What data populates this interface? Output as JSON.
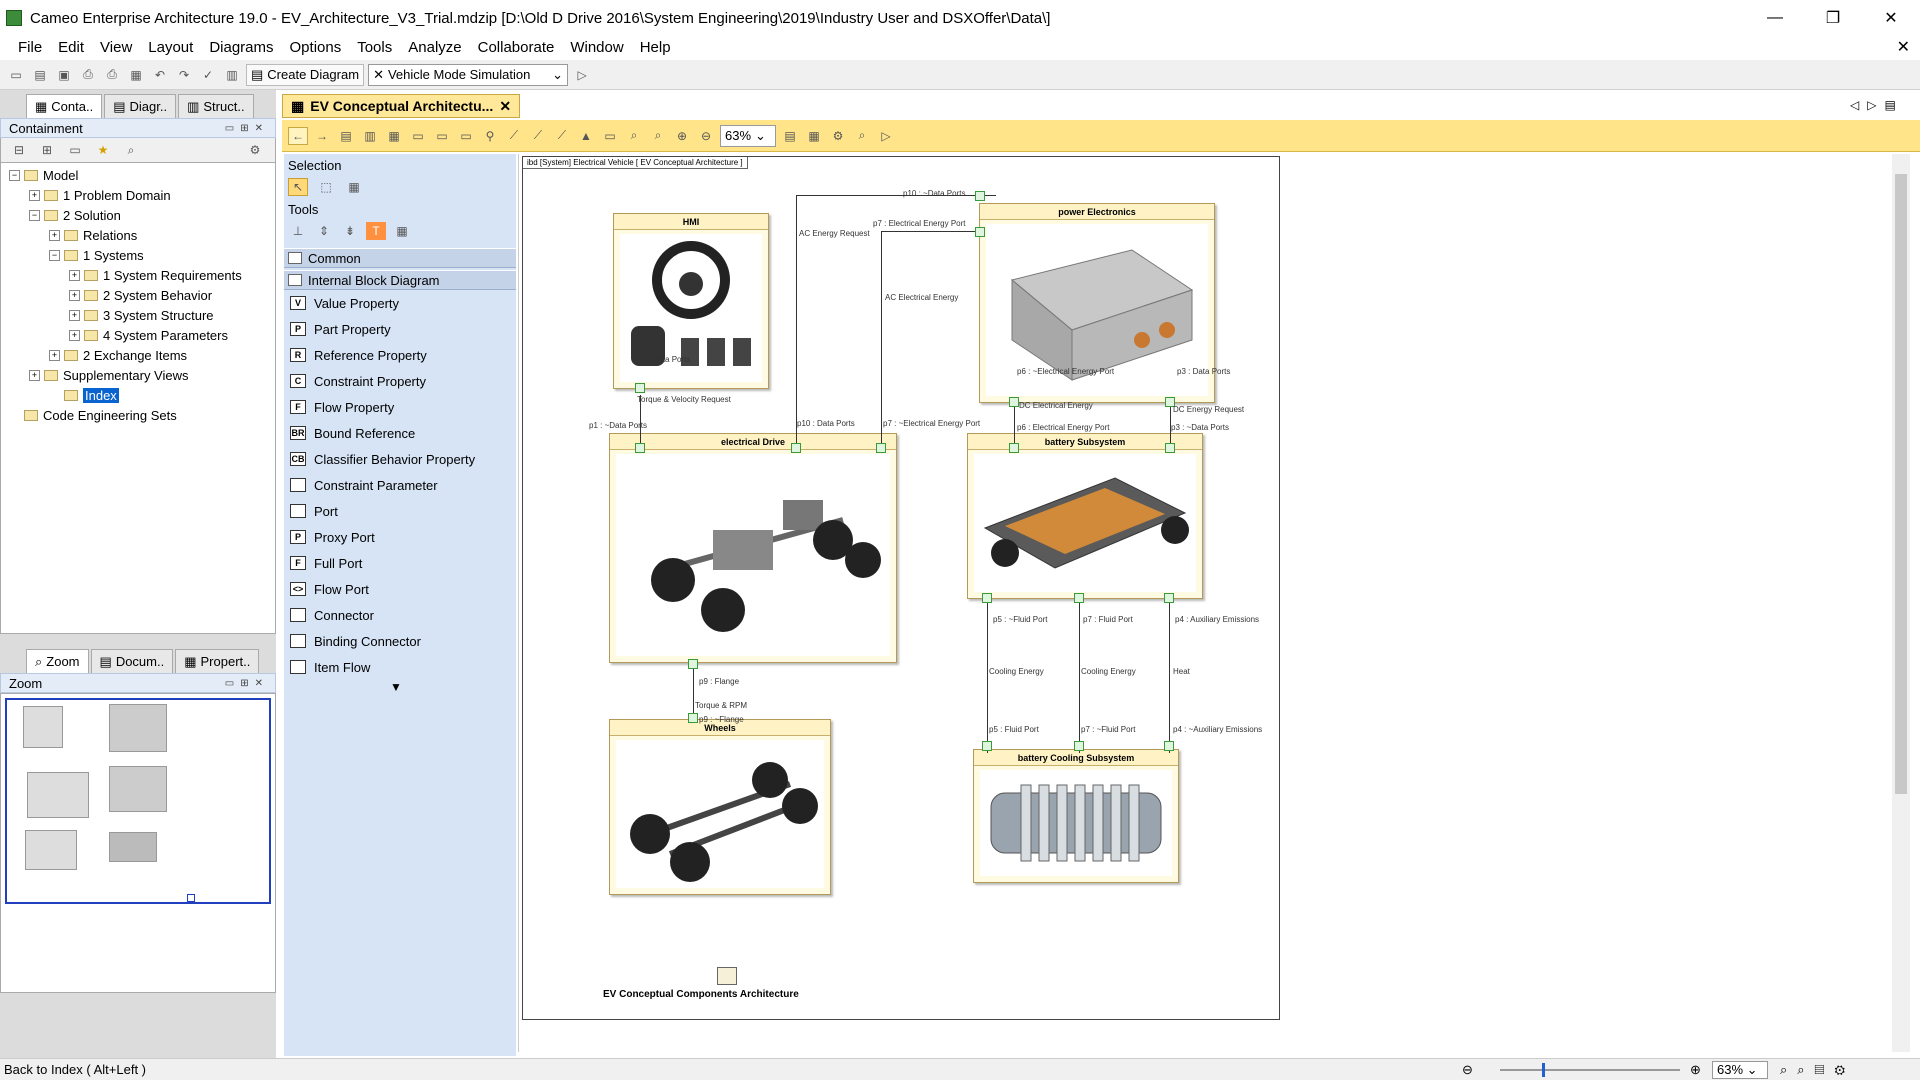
{
  "window": {
    "title": "Cameo Enterprise Architecture 19.0 - EV_Architecture_V3_Trial.mdzip [D:\\Old D Drive 2016\\System Engineering\\2019\\Industry User and DSXOffer\\Data\\]",
    "minimize": "—",
    "restore": "❐",
    "close": "✕"
  },
  "menu": [
    "File",
    "Edit",
    "View",
    "Layout",
    "Diagrams",
    "Options",
    "Tools",
    "Analyze",
    "Collaborate",
    "Window",
    "Help"
  ],
  "toolbar": {
    "create_diagram": "Create Diagram",
    "simulation_select": "Vehicle Mode Simulation"
  },
  "left_tabs": [
    "Conta..",
    "Diagr..",
    "Struct.."
  ],
  "containment": {
    "title": "Containment",
    "tree": [
      {
        "label": "Model",
        "level": 0,
        "exp": "−"
      },
      {
        "label": "1 Problem Domain",
        "level": 1,
        "exp": "+"
      },
      {
        "label": "2 Solution",
        "level": 1,
        "exp": "−"
      },
      {
        "label": "Relations",
        "level": 2,
        "exp": "+"
      },
      {
        "label": "1 Systems",
        "level": 2,
        "exp": "−"
      },
      {
        "label": "1 System Requirements",
        "level": 3,
        "exp": "+"
      },
      {
        "label": "2 System Behavior",
        "level": 3,
        "exp": "+"
      },
      {
        "label": "3 System Structure",
        "level": 3,
        "exp": "+"
      },
      {
        "label": "4 System Parameters",
        "level": 3,
        "exp": "+"
      },
      {
        "label": "2 Exchange Items",
        "level": 2,
        "exp": "+"
      },
      {
        "label": "Supplementary Views",
        "level": 1,
        "exp": "+"
      },
      {
        "label": "Index",
        "level": 2,
        "exp": "",
        "selected": true
      },
      {
        "label": "Code Engineering Sets",
        "level": 0,
        "exp": ""
      }
    ]
  },
  "bottom_tabs": [
    "Zoom",
    "Docum..",
    "Propert.."
  ],
  "zoom_panel": {
    "title": "Zoom"
  },
  "diagram_tab": {
    "label": "EV Conceptual Architectu..."
  },
  "zoom_level": "63%",
  "palette": {
    "selection": "Selection",
    "tools": "Tools",
    "categories": [
      "Common",
      "Internal Block Diagram"
    ],
    "items": [
      {
        "icon": "V",
        "label": "Value Property"
      },
      {
        "icon": "P",
        "label": "Part Property"
      },
      {
        "icon": "R",
        "label": "Reference Property"
      },
      {
        "icon": "C",
        "label": "Constraint Property"
      },
      {
        "icon": "F",
        "label": "Flow Property"
      },
      {
        "icon": "BR",
        "label": "Bound Reference"
      },
      {
        "icon": "CB",
        "label": "Classifier Behavior Property"
      },
      {
        "icon": "",
        "label": "Constraint Parameter"
      },
      {
        "icon": "",
        "label": "Port"
      },
      {
        "icon": "P",
        "label": "Proxy Port"
      },
      {
        "icon": "F",
        "label": "Full Port"
      },
      {
        "icon": "<>",
        "label": "Flow Port"
      },
      {
        "icon": "",
        "label": "Connector"
      },
      {
        "icon": "",
        "label": "Binding Connector"
      },
      {
        "icon": "",
        "label": "Item Flow"
      }
    ]
  },
  "diagram": {
    "frame_tag": "ibd [System] Electrical Vehicle [ EV Conceptual Architecture ]",
    "caption": "EV Conceptual Components Architecture",
    "blocks": {
      "hmi": "HMI",
      "power": "power Electronics",
      "drive": "electrical Drive",
      "battery": "battery Subsystem",
      "wheels": "Wheels",
      "cooling": "battery Cooling Subsystem"
    },
    "labels": {
      "p10_data": "p10 : ~Data Ports",
      "ac_energy_req": "AC Energy Request",
      "p7_elec": "p7 : Electrical Energy Port",
      "ac_elec": "AC Electrical Energy",
      "p1_data": "p1 : Data Ports",
      "torque_vel": "Torque & Velocity Request",
      "p1_tdata": "p1 : ~Data Ports",
      "p10_data2": "p10 : Data Ports",
      "p7_telec": "p7 : ~Electrical Energy Port",
      "p6_telec": "p6 : ~Electrical Energy Port",
      "p3_data": "p3 : Data Ports",
      "dc_elec": "DC Electrical Energy",
      "dc_energy_req": "DC Energy Request",
      "p6_elec": "p6 : Electrical Energy Port",
      "p3_tdata": "p3 : ~Data Ports",
      "p9_flange": "p9 : Flange",
      "torque_rpm": "Torque & RPM",
      "p9_tflange": "p9 : ~Flange",
      "p5_tfluid": "p5 : ~Fluid Port",
      "p7_fluid": "p7 : Fluid Port",
      "p4_aux": "p4 : Auxiliary Emissions",
      "cooling1": "Cooling Energy",
      "cooling2": "Cooling Energy",
      "heat": "Heat",
      "p5_fluid": "p5 : Fluid Port",
      "p7_tfluid": "p7 : ~Fluid Port",
      "p4_taux": "p4 : ~Auxiliary Emissions"
    }
  },
  "status": {
    "text": "Back to Index ( Alt+Left )",
    "zoom": "63%"
  }
}
